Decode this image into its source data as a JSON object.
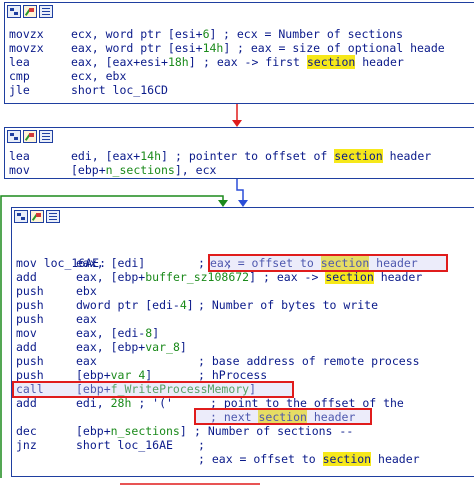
{
  "colors": {
    "border": "#1f3fa0",
    "text": "#0a1a8a",
    "number": "#1b8a1b",
    "highlight": "#f6e81a",
    "annotation_box": "#e01c1c",
    "edge_red": "#e01c1c",
    "edge_blue": "#2b4fd8",
    "edge_green": "#1b8a1b"
  },
  "toolbar_icons": [
    "graph-overview-icon",
    "edit-node-icon",
    "list-view-icon"
  ],
  "block1": {
    "lines": [
      {
        "mn": "movzx",
        "op": [
          "ecx, word ptr [esi+",
          {
            "num": "6"
          },
          "]"
        ],
        "cm": [
          "; ecx = Number of sections"
        ]
      },
      {
        "mn": "movzx",
        "op": [
          "eax, word ptr [esi+",
          {
            "num": "14h"
          },
          "]"
        ],
        "cm": [
          "; eax = size of optional heade"
        ]
      },
      {
        "mn": "lea",
        "op": [
          "eax, [eax+esi+",
          {
            "num": "18h"
          },
          "]"
        ],
        "cm": [
          "; eax -> first ",
          {
            "hl": "section"
          },
          " header"
        ]
      },
      {
        "mn": "cmp",
        "op": [
          "ecx, ebx"
        ],
        "cm": []
      },
      {
        "mn": "jle",
        "op": [
          "short loc_16CD"
        ],
        "cm": []
      }
    ]
  },
  "block2": {
    "lines": [
      {
        "mn": "lea",
        "op": [
          "edi, [eax+",
          {
            "num": "14h"
          },
          "]"
        ],
        "cm": [
          "; pointer to offset of ",
          {
            "hl": "section"
          },
          " header"
        ]
      },
      {
        "mn": "mov",
        "op": [
          "[ebp+",
          {
            "field": "n_sections"
          },
          "], ecx"
        ],
        "cm": []
      }
    ]
  },
  "block3": {
    "label": "loc_16AE:",
    "label_cm": ";",
    "lines": [
      {
        "mn": "mov",
        "op": [
          "eax, [edi]"
        ],
        "cm": [
          ";"
        ],
        "cm2": [
          "eax = offset to ",
          {
            "hl": "section"
          },
          " header"
        ]
      },
      {
        "mn": "add",
        "op": [
          "eax, [ebp+",
          {
            "field": "buffer_sz108672"
          },
          "]"
        ],
        "cm": [
          "; eax -> ",
          {
            "hl": "section"
          },
          " header"
        ]
      },
      {
        "mn": "push",
        "op": [
          "ebx"
        ],
        "cm": []
      },
      {
        "mn": "push",
        "op": [
          "dword ptr [edi-",
          {
            "num": "4"
          },
          "]"
        ],
        "cm": [
          "; Number of bytes to write"
        ]
      },
      {
        "mn": "push",
        "op": [
          "eax"
        ],
        "cm": []
      },
      {
        "mn": "mov",
        "op": [
          "eax, [edi-",
          {
            "num": "8"
          },
          "]"
        ],
        "cm": []
      },
      {
        "mn": "add",
        "op": [
          "eax, [ebp+",
          {
            "field": "var_8"
          },
          "]"
        ],
        "cm": []
      },
      {
        "mn": "push",
        "op": [
          "eax"
        ],
        "cm": [
          "; base address of remote process"
        ]
      },
      {
        "mn": "push",
        "op": [
          "[ebp+",
          {
            "field": "var_4"
          },
          "]"
        ],
        "cm": [
          "; hProcess"
        ]
      },
      {
        "mn": "call",
        "op": [
          "[ebp+",
          {
            "field": "f_WriteProcessMemory"
          },
          "]"
        ],
        "cm": []
      },
      {
        "mn": "add",
        "op": [
          "edi, ",
          {
            "num": "28h"
          },
          " ; '('"
        ],
        "cm": [
          "; point to the offset of the"
        ]
      },
      {
        "mn": "",
        "op": [
          ""
        ],
        "cm": [
          "; next ",
          {
            "hl": "section"
          },
          " header"
        ]
      },
      {
        "mn": "dec",
        "op": [
          "[ebp+",
          {
            "field": "n_sections"
          },
          "]"
        ],
        "cm": [
          "; Number of sections --"
        ]
      },
      {
        "mn": "jnz",
        "op": [
          "short loc_16AE"
        ],
        "cm": [
          ";"
        ]
      },
      {
        "mn": "",
        "op": [
          ""
        ],
        "cm": [
          "; eax = offset to ",
          {
            "hl": "section"
          },
          " header"
        ]
      }
    ]
  }
}
